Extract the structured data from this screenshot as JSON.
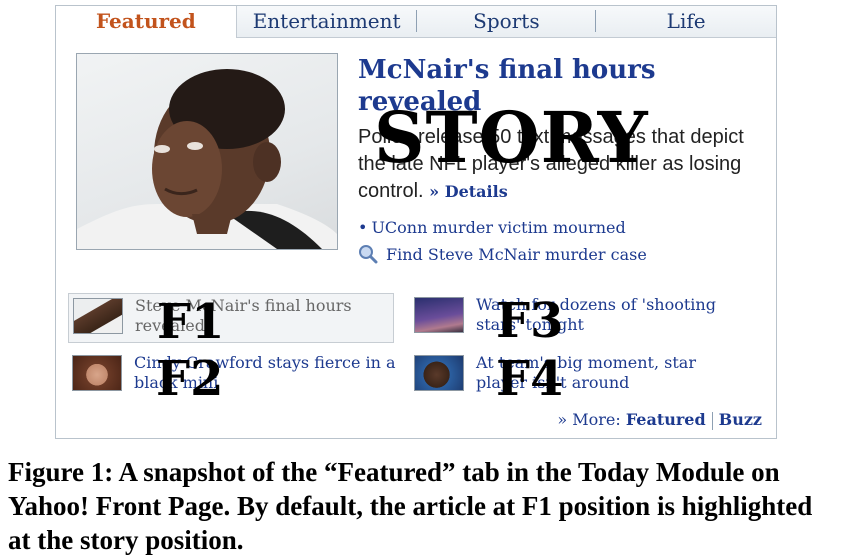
{
  "tabs": [
    {
      "label": "Featured",
      "active": true
    },
    {
      "label": "Entertainment",
      "active": false
    },
    {
      "label": "Sports",
      "active": false
    },
    {
      "label": "Life",
      "active": false
    }
  ],
  "story": {
    "title": "McNair's final hours revealed",
    "body": "Police release 50 text messages that depict the late NFL player's alleged killer as losing control.",
    "details_label": "» Details",
    "overlay_label": "STORY",
    "related_link": "UConn murder victim mourned",
    "search_link": "Find Steve McNair murder case"
  },
  "features": [
    {
      "label": "F1",
      "text": "Steve McNair's final hours revealed"
    },
    {
      "label": "F2",
      "text": "Cindy Crawford stays fierce in a black mini"
    },
    {
      "label": "F3",
      "text": "Watch for dozens of 'shooting stars' tonight"
    },
    {
      "label": "F4",
      "text": "At team's big moment, star player isn't around"
    }
  ],
  "more": {
    "prefix": "» More:",
    "featured": "Featured",
    "buzz": "Buzz"
  },
  "caption": "Figure 1: A snapshot of the “Featured” tab in the Today Module on Yahoo! Front Page. By default, the article at F1 position is highlighted at the story position.",
  "colors": {
    "active_tab": "#c2531c",
    "link": "#1d3a8f"
  }
}
